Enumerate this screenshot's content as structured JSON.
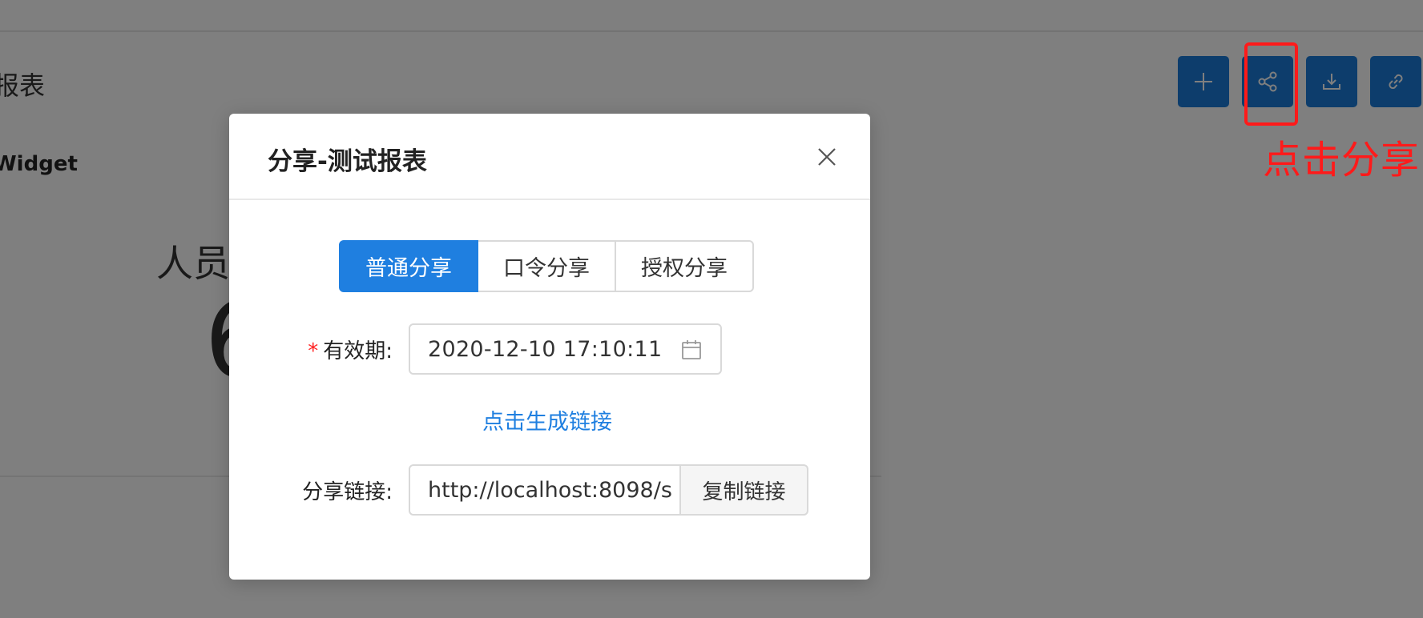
{
  "background": {
    "report_title": "报表",
    "widget_label": "Widget",
    "card_label": "人员",
    "card_value": "6"
  },
  "toolbar": {
    "buttons": [
      {
        "name": "add-button",
        "icon": "plus-icon"
      },
      {
        "name": "share-button",
        "icon": "share-icon"
      },
      {
        "name": "download-button",
        "icon": "download-icon"
      },
      {
        "name": "link-button",
        "icon": "link-icon"
      }
    ]
  },
  "annotation": {
    "caption": "点击分享",
    "color": "#ff1a1a"
  },
  "modal": {
    "title": "分享-测试报表",
    "tabs": [
      "普通分享",
      "口令分享",
      "授权分享"
    ],
    "active_tab": "普通分享",
    "expiry": {
      "required_mark": "*",
      "label": "有效期:",
      "value": "2020-12-10 17:10:11"
    },
    "generate_link_label": "点击生成链接",
    "share_link": {
      "label": "分享链接:",
      "value": "http://localhost:8098/s",
      "copy_label": "复制链接"
    }
  },
  "colors": {
    "primary": "#1f7fe0",
    "toolbar_button": "#1a7ad9",
    "overlay": "rgba(0,0,0,0.5)"
  }
}
